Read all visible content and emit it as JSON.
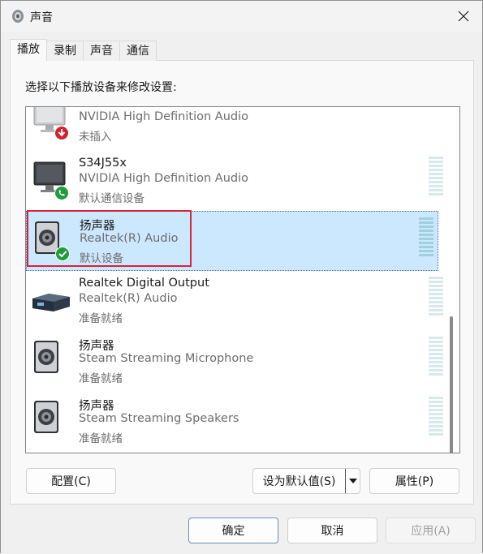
{
  "window": {
    "title": "声音"
  },
  "tabs": [
    {
      "label": "播放",
      "active": true
    },
    {
      "label": "录制",
      "active": false
    },
    {
      "label": "声音",
      "active": false
    },
    {
      "label": "通信",
      "active": false
    }
  ],
  "instruction": "选择以下播放设备来修改设置:",
  "devices": [
    {
      "name": "",
      "description": "NVIDIA High Definition Audio",
      "status": "未插入",
      "icon": "monitor-icon",
      "badge": "unplugged-arrow-badge"
    },
    {
      "name": "S34J55x",
      "description": "NVIDIA High Definition Audio",
      "status": "默认通信设备",
      "icon": "monitor-icon",
      "badge": "phone-badge"
    },
    {
      "name": "扬声器",
      "description": "Realtek(R) Audio",
      "status": "默认设备",
      "icon": "speaker-icon",
      "badge": "check-badge",
      "selected": true
    },
    {
      "name": "Realtek Digital Output",
      "description": "Realtek(R) Audio",
      "status": "准备就绪",
      "icon": "digital-output-icon"
    },
    {
      "name": "扬声器",
      "description": "Steam Streaming Microphone",
      "status": "准备就绪",
      "icon": "speaker-icon"
    },
    {
      "name": "扬声器",
      "description": "Steam Streaming Speakers",
      "status": "准备就绪",
      "icon": "speaker-icon"
    }
  ],
  "buttons": {
    "configure": "配置(C)",
    "set_default": "设为默认值(S)",
    "properties": "属性(P)",
    "ok": "确定",
    "cancel": "取消",
    "apply": "应用(A)"
  },
  "colors": {
    "selection": "#cce8ff",
    "highlight_border": "#d6243a",
    "green_badge": "#1f9d3a",
    "red_badge": "#d4202c"
  }
}
